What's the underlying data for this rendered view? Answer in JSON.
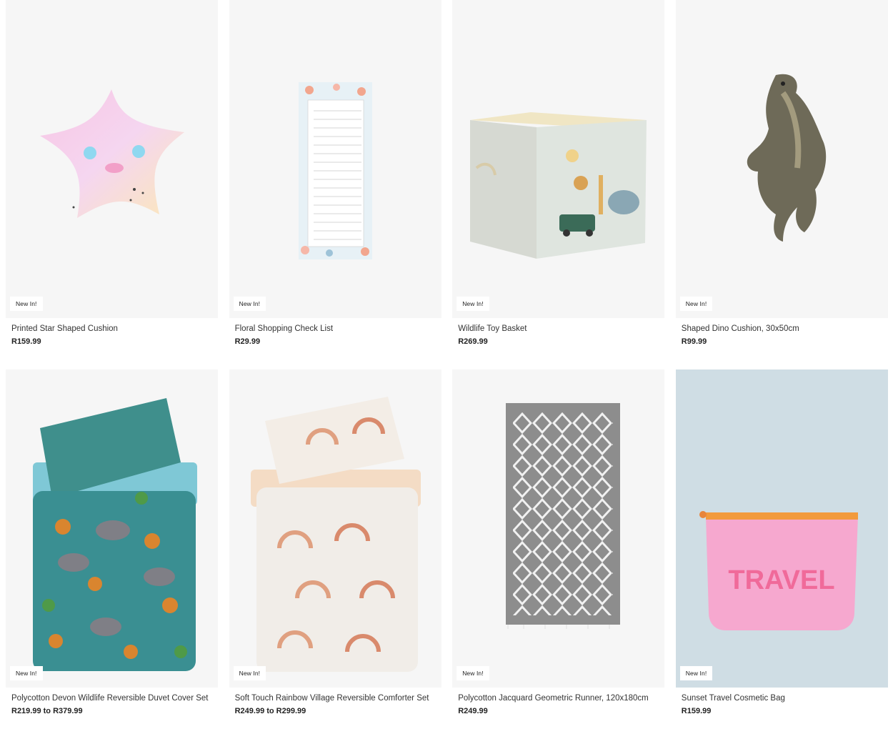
{
  "products": [
    {
      "badge": "New In!",
      "title": "Printed Star Shaped Cushion",
      "price": "R159.99",
      "icon": "star-cushion"
    },
    {
      "badge": "New In!",
      "title": "Floral Shopping Check List",
      "price": "R29.99",
      "icon": "checklist-notepad"
    },
    {
      "badge": "New In!",
      "title": "Wildlife Toy Basket",
      "price": "R269.99",
      "icon": "toy-basket"
    },
    {
      "badge": "New In!",
      "title": "Shaped Dino Cushion, 30x50cm",
      "price": "R99.99",
      "icon": "dino-cushion"
    },
    {
      "badge": "New In!",
      "title": "Polycotton Devon Wildlife Reversible Duvet Cover Set",
      "price": "R219.99 to R379.99",
      "icon": "duvet-set"
    },
    {
      "badge": "New In!",
      "title": "Soft Touch Rainbow Village Reversible Comforter Set",
      "price": "R249.99 to R299.99",
      "icon": "comforter-set"
    },
    {
      "badge": "New In!",
      "title": "Polycotton Jacquard Geometric Runner, 120x180cm",
      "price": "R249.99",
      "icon": "runner-rug"
    },
    {
      "badge": "New In!",
      "title": "Sunset Travel Cosmetic Bag",
      "price": "R159.99",
      "icon": "cosmetic-bag",
      "print": "TRAVEL"
    }
  ]
}
